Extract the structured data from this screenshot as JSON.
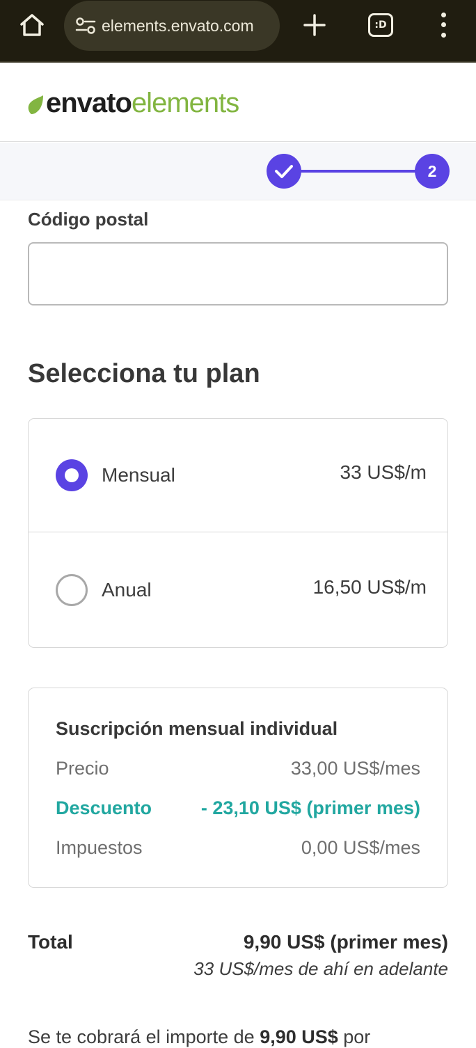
{
  "browser": {
    "url": "elements.envato.com",
    "tab_count": ":D"
  },
  "header": {
    "logo_word1": "envato",
    "logo_word2": "elements"
  },
  "stepper": {
    "step2_label": "2"
  },
  "form": {
    "postal_label": "Código postal",
    "postal_value": ""
  },
  "plan": {
    "heading": "Selecciona tu plan",
    "options": [
      {
        "name": "Mensual",
        "price": "33 US$/m",
        "selected": true
      },
      {
        "name": "Anual",
        "price": "16,50 US$/m",
        "selected": false
      }
    ]
  },
  "summary": {
    "title": "Suscripción mensual individual",
    "rows": [
      {
        "label": "Precio",
        "value": "33,00 US$/mes"
      },
      {
        "label": "Descuento",
        "value": "- 23,10 US$ (primer mes)"
      },
      {
        "label": "Impuestos",
        "value": "0,00 US$/mes"
      }
    ]
  },
  "total": {
    "label": "Total",
    "value": "9,90 US$ (primer mes)",
    "after": "33 US$/mes de ahí en adelante"
  },
  "charge_note": {
    "prefix": "Se te cobrará el importe de ",
    "amount": "9,90 US$",
    "suffix": " por"
  },
  "colors": {
    "accent": "#5a43e3",
    "discount": "#21a7a0",
    "brand_green": "#82b541",
    "chrome_bg": "#201d10"
  }
}
